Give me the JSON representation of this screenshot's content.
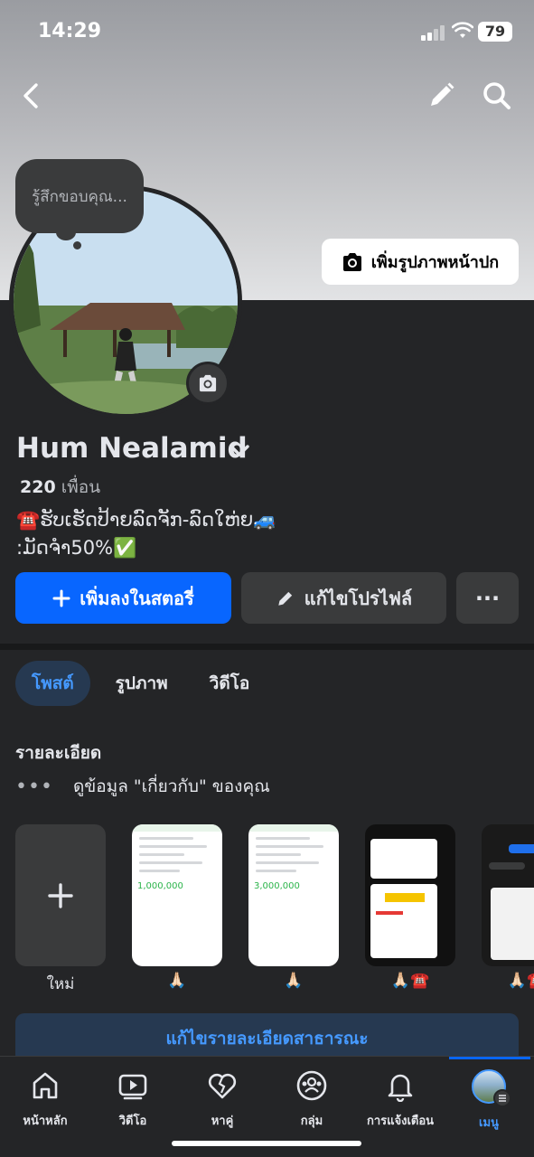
{
  "status_bar": {
    "time": "14:29",
    "battery": "79"
  },
  "header": {
    "back_icon": "chevron-left-icon",
    "edit_icon": "pencil-icon",
    "search_icon": "search-icon"
  },
  "cover": {
    "add_cover_label": "เพิ่มรูปภาพหน้าปก"
  },
  "thought_bubble": "รู้สึกขอบคุณ...",
  "profile": {
    "name": "Hum Nealamid",
    "friends_count": "220",
    "friends_label": "เพื่อน",
    "bio_line1": "☎️ຮັບເຮັດປ້າຍລົດຈັກ-ລົດໃຫ່ຍ🚙",
    "bio_line2": ":ມັດຈໍາ50%✅"
  },
  "actions": {
    "add_story": "เพิ่มลงในสตอรี่",
    "edit_profile": "แก้ไขโปรไฟล์",
    "more": "···"
  },
  "tabs": [
    "โพสต์",
    "รูปภาพ",
    "วิดีโอ"
  ],
  "details": {
    "title": "รายละเอียด",
    "about_text": "ดูข้อมูล \"เกี่ยวกับ\" ของคุณ"
  },
  "highlights": [
    {
      "caption": "ใหม่"
    },
    {
      "caption": "🙏🏻",
      "amount": "1,000,000"
    },
    {
      "caption": "🙏🏻",
      "amount": "3,000,000"
    },
    {
      "caption": "🙏🏻☎️"
    },
    {
      "caption": "🙏🏻☎️"
    }
  ],
  "edit_public_details": "แก้ไขรายละเอียดสาธารณะ",
  "bottom_nav": [
    {
      "label": "หน้าหลัก",
      "icon": "home-icon"
    },
    {
      "label": "วิดีโอ",
      "icon": "video-icon"
    },
    {
      "label": "หาคู่",
      "icon": "dating-heart-icon"
    },
    {
      "label": "กลุ่ม",
      "icon": "groups-icon"
    },
    {
      "label": "การแจ้งเตือน",
      "icon": "bell-icon"
    },
    {
      "label": "เมนู",
      "icon": "menu-avatar-icon"
    }
  ],
  "colors": {
    "accent": "#0866ff",
    "active_text": "#4599ff",
    "background": "#242527",
    "surface": "#3a3b3c"
  }
}
